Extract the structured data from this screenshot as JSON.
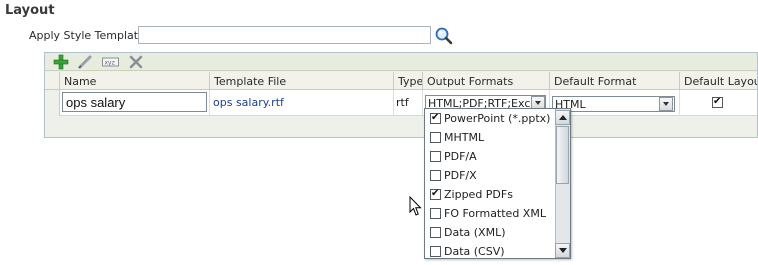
{
  "section": {
    "title": "Layout"
  },
  "style_template": {
    "label": "Apply Style Template",
    "value": ""
  },
  "toolbar": {
    "add_icon": "add-icon",
    "edit_icon": "edit-icon",
    "xyz_icon": "xyz-icon",
    "delete_icon": "delete-icon"
  },
  "table": {
    "columns": [
      "Name",
      "Template File",
      "Type",
      "Output Formats",
      "Default Format",
      "Default Layout"
    ],
    "row": {
      "name": "ops salary",
      "template_file": "ops salary.rtf",
      "type": "rtf",
      "output_formats": "HTML;PDF;RTF;Excel",
      "default_format": "HTML",
      "default_layout": true
    }
  },
  "output_formats_dropdown": {
    "options": [
      {
        "label": "PowerPoint (*.pptx)",
        "checked": true
      },
      {
        "label": "MHTML",
        "checked": false
      },
      {
        "label": "PDF/A",
        "checked": false
      },
      {
        "label": "PDF/X",
        "checked": false
      },
      {
        "label": "Zipped PDFs",
        "checked": true
      },
      {
        "label": "FO Formatted XML",
        "checked": false
      },
      {
        "label": "Data (XML)",
        "checked": false
      },
      {
        "label": "Data (CSV)",
        "checked": false
      }
    ]
  },
  "colors": {
    "link": "#1c3f8c",
    "toolbar_bg": "#e7ecdf",
    "header_bg": "#f2f2ea",
    "border": "#b5c2cf"
  }
}
